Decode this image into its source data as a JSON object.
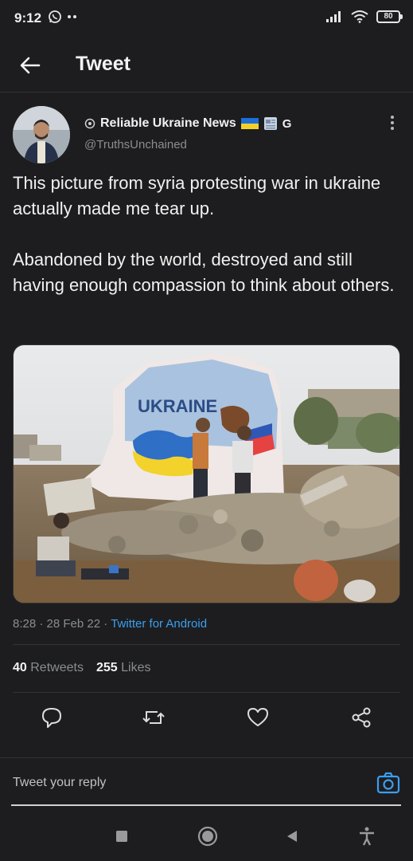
{
  "status_bar": {
    "time": "9:12",
    "battery": "80"
  },
  "header": {
    "title": "Tweet"
  },
  "tweet": {
    "author_name": "Reliable Ukraine News",
    "author_badge": "G",
    "handle": "@TruthsUnchained",
    "text": "This picture from syria protesting war in ukraine actually made me tear up.\n\nAbandoned by the world, destroyed and still having enough compassion to think about others.",
    "image_caption_text": "UKRAINE",
    "time": "8:28",
    "date": "28 Feb 22",
    "source": "Twitter for Android",
    "retweets_count": "40",
    "retweets_label": "Retweets",
    "likes_count": "255",
    "likes_label": "Likes"
  },
  "reply": {
    "placeholder": "Tweet your reply"
  },
  "colors": {
    "accent": "#3a9ff0",
    "background": "#1d1d1f",
    "muted": "#8a8d91"
  }
}
